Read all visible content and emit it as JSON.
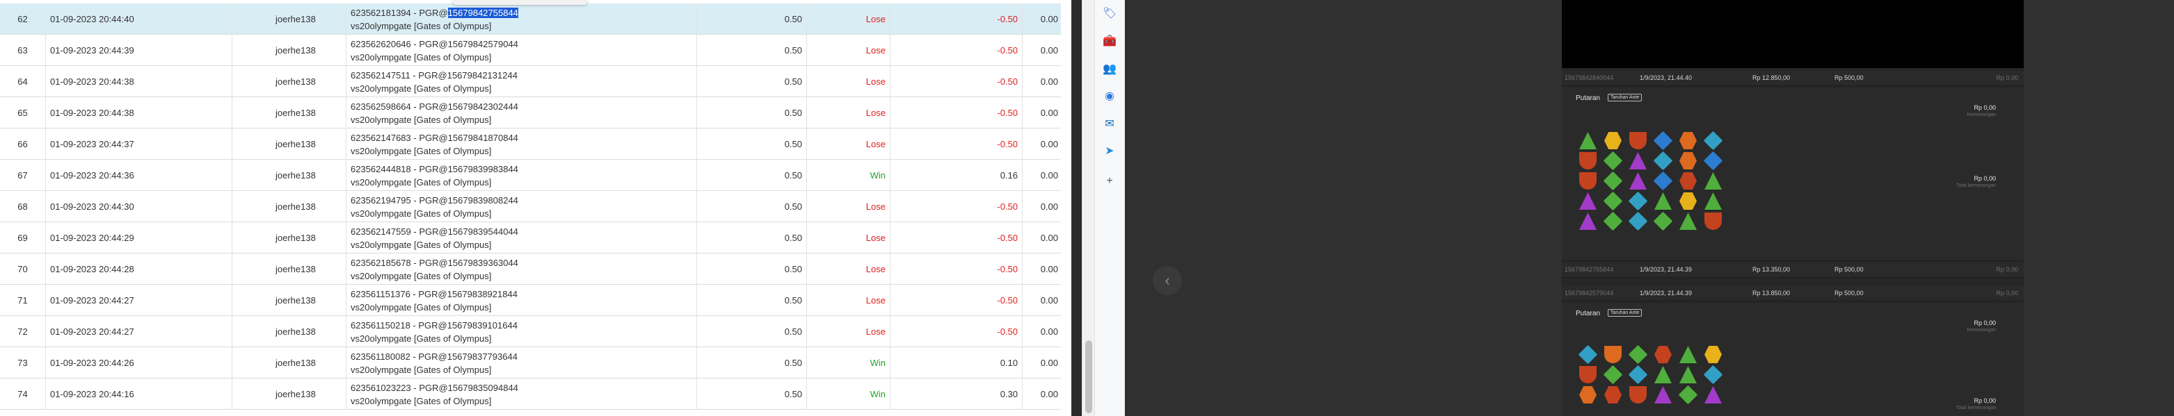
{
  "table": {
    "rows": [
      {
        "no": "62",
        "date": "01-09-2023 20:44:40",
        "user": "joerhe138",
        "desc_prefix": "623562181394 - PGR@",
        "desc_hl": "15679842755844",
        "desc2": "vs20olympgate [Gates of Olympus]",
        "bet": "0.50",
        "result": "Lose",
        "net": "-0.50",
        "balance": "0.00"
      },
      {
        "no": "63",
        "date": "01-09-2023 20:44:39",
        "user": "joerhe138",
        "desc": "623562620646 - PGR@15679842579044",
        "desc2": "vs20olympgate [Gates of Olympus]",
        "bet": "0.50",
        "result": "Lose",
        "net": "-0.50",
        "balance": "0.00"
      },
      {
        "no": "64",
        "date": "01-09-2023 20:44:38",
        "user": "joerhe138",
        "desc": "623562147511 - PGR@15679842131244",
        "desc2": "vs20olympgate [Gates of Olympus]",
        "bet": "0.50",
        "result": "Lose",
        "net": "-0.50",
        "balance": "0.00"
      },
      {
        "no": "65",
        "date": "01-09-2023 20:44:38",
        "user": "joerhe138",
        "desc": "623562598664 - PGR@15679842302444",
        "desc2": "vs20olympgate [Gates of Olympus]",
        "bet": "0.50",
        "result": "Lose",
        "net": "-0.50",
        "balance": "0.00"
      },
      {
        "no": "66",
        "date": "01-09-2023 20:44:37",
        "user": "joerhe138",
        "desc": "623562147683 - PGR@15679841870844",
        "desc2": "vs20olympgate [Gates of Olympus]",
        "bet": "0.50",
        "result": "Lose",
        "net": "-0.50",
        "balance": "0.00"
      },
      {
        "no": "67",
        "date": "01-09-2023 20:44:36",
        "user": "joerhe138",
        "desc": "623562444818 - PGR@15679839983844",
        "desc2": "vs20olympgate [Gates of Olympus]",
        "bet": "0.50",
        "result": "Win",
        "net": "0.16",
        "balance": "0.00"
      },
      {
        "no": "68",
        "date": "01-09-2023 20:44:30",
        "user": "joerhe138",
        "desc": "623562194795 - PGR@15679839808244",
        "desc2": "vs20olympgate [Gates of Olympus]",
        "bet": "0.50",
        "result": "Lose",
        "net": "-0.50",
        "balance": "0.00"
      },
      {
        "no": "69",
        "date": "01-09-2023 20:44:29",
        "user": "joerhe138",
        "desc": "623562147559 - PGR@15679839544044",
        "desc2": "vs20olympgate [Gates of Olympus]",
        "bet": "0.50",
        "result": "Lose",
        "net": "-0.50",
        "balance": "0.00"
      },
      {
        "no": "70",
        "date": "01-09-2023 20:44:28",
        "user": "joerhe138",
        "desc": "623562185678 - PGR@15679839363044",
        "desc2": "vs20olympgate [Gates of Olympus]",
        "bet": "0.50",
        "result": "Lose",
        "net": "-0.50",
        "balance": "0.00"
      },
      {
        "no": "71",
        "date": "01-09-2023 20:44:27",
        "user": "joerhe138",
        "desc": "623561151376 - PGR@15679838921844",
        "desc2": "vs20olympgate [Gates of Olympus]",
        "bet": "0.50",
        "result": "Lose",
        "net": "-0.50",
        "balance": "0.00"
      },
      {
        "no": "72",
        "date": "01-09-2023 20:44:27",
        "user": "joerhe138",
        "desc": "623561150218 - PGR@15679839101644",
        "desc2": "vs20olympgate [Gates of Olympus]",
        "bet": "0.50",
        "result": "Lose",
        "net": "-0.50",
        "balance": "0.00"
      },
      {
        "no": "73",
        "date": "01-09-2023 20:44:26",
        "user": "joerhe138",
        "desc": "623561180082 - PGR@15679837793644",
        "desc2": "vs20olympgate [Gates of Olympus]",
        "bet": "0.50",
        "result": "Win",
        "net": "0.10",
        "balance": "0.00"
      },
      {
        "no": "74",
        "date": "01-09-2023 20:44:16",
        "user": "joerhe138",
        "desc": "623561023223 - PGR@15679835094844",
        "desc2": "vs20olympgate [Gates of Olympus]",
        "bet": "0.50",
        "result": "Win",
        "net": "0.30",
        "balance": "0.00"
      }
    ]
  },
  "sidebar_icons": [
    {
      "name": "tag-icon",
      "glyph": "🏷",
      "color": "#3b6fd8"
    },
    {
      "name": "toolbox-icon",
      "glyph": "🧰",
      "color": "#d2552b"
    },
    {
      "name": "people-icon",
      "glyph": "👥",
      "color": "#6a3fb5"
    },
    {
      "name": "copilot-icon",
      "glyph": "◉",
      "color": "#2d7be0"
    },
    {
      "name": "outlook-icon",
      "glyph": "✉",
      "color": "#0f6cbd"
    },
    {
      "name": "send-icon",
      "glyph": "➤",
      "color": "#1f8fd6"
    },
    {
      "name": "add-icon",
      "glyph": "+",
      "color": "#555555"
    }
  ],
  "game_history": {
    "nav_prev": "‹",
    "rows": [
      {
        "id": "15679842840044",
        "date": "1/9/2023, 21.44.40",
        "balance": "Rp 12.850,00",
        "bet": "Rp 500,00",
        "win": "Rp 0,00"
      },
      {
        "id": "15679842755844",
        "date": "1/9/2023, 21.44.39",
        "balance": "Rp 13.350,00",
        "bet": "Rp 500,00",
        "win": "Rp 0,00"
      },
      {
        "id": "15679842579044",
        "date": "1/9/2023, 21.44.39",
        "balance": "Rp 13.850,00",
        "bet": "Rp 500,00",
        "win": "Rp 0,00"
      }
    ],
    "rounds": [
      {
        "title": "Putaran",
        "badge": "Taruhan Ante",
        "amount_top": "Rp 0,00",
        "sub_top": "Kemenangan",
        "amount_mid": "Rp 0,00",
        "sub_mid": "Total kemenangan"
      },
      {
        "title": "Putaran",
        "badge": "Taruhan Ante",
        "amount_top": "Rp 0,00",
        "sub_top": "Kemenangan",
        "amount_mid": "Rp 0,00",
        "sub_mid": "Total kemenangan"
      }
    ],
    "symbols": {
      "round1": [
        "tri-g",
        "hex-y",
        "cup-r",
        "dia-b",
        "hex-o",
        "dia-c",
        "cup-r",
        "dia-g",
        "tri-p",
        "dia-c",
        "hex-o",
        "dia-b",
        "cup-r",
        "dia-g",
        "tri-p",
        "dia-b",
        "hex-r",
        "tri-g",
        "tri-p",
        "dia-g",
        "dia-c",
        "tri-g",
        "hex-y",
        "tri-g",
        "tri-p",
        "dia-g",
        "dia-c",
        "dia-g",
        "tri-g",
        "cup-r"
      ],
      "round2": [
        "dia-c",
        "cup-o",
        "dia-g",
        "hex-r",
        "tri-g",
        "hex-y",
        "cup-r",
        "dia-g",
        "dia-c",
        "tri-g",
        "tri-g",
        "dia-c",
        "hex-o",
        "hex-r",
        "cup-r",
        "tri-p",
        "dia-g",
        "tri-p"
      ]
    },
    "colors": {
      "g": "#4fae3c",
      "y": "#e8b21a",
      "r": "#c5421f",
      "b": "#2c7ccf",
      "o": "#dd6a1e",
      "c": "#32a0c4",
      "p": "#a23bc9"
    }
  }
}
